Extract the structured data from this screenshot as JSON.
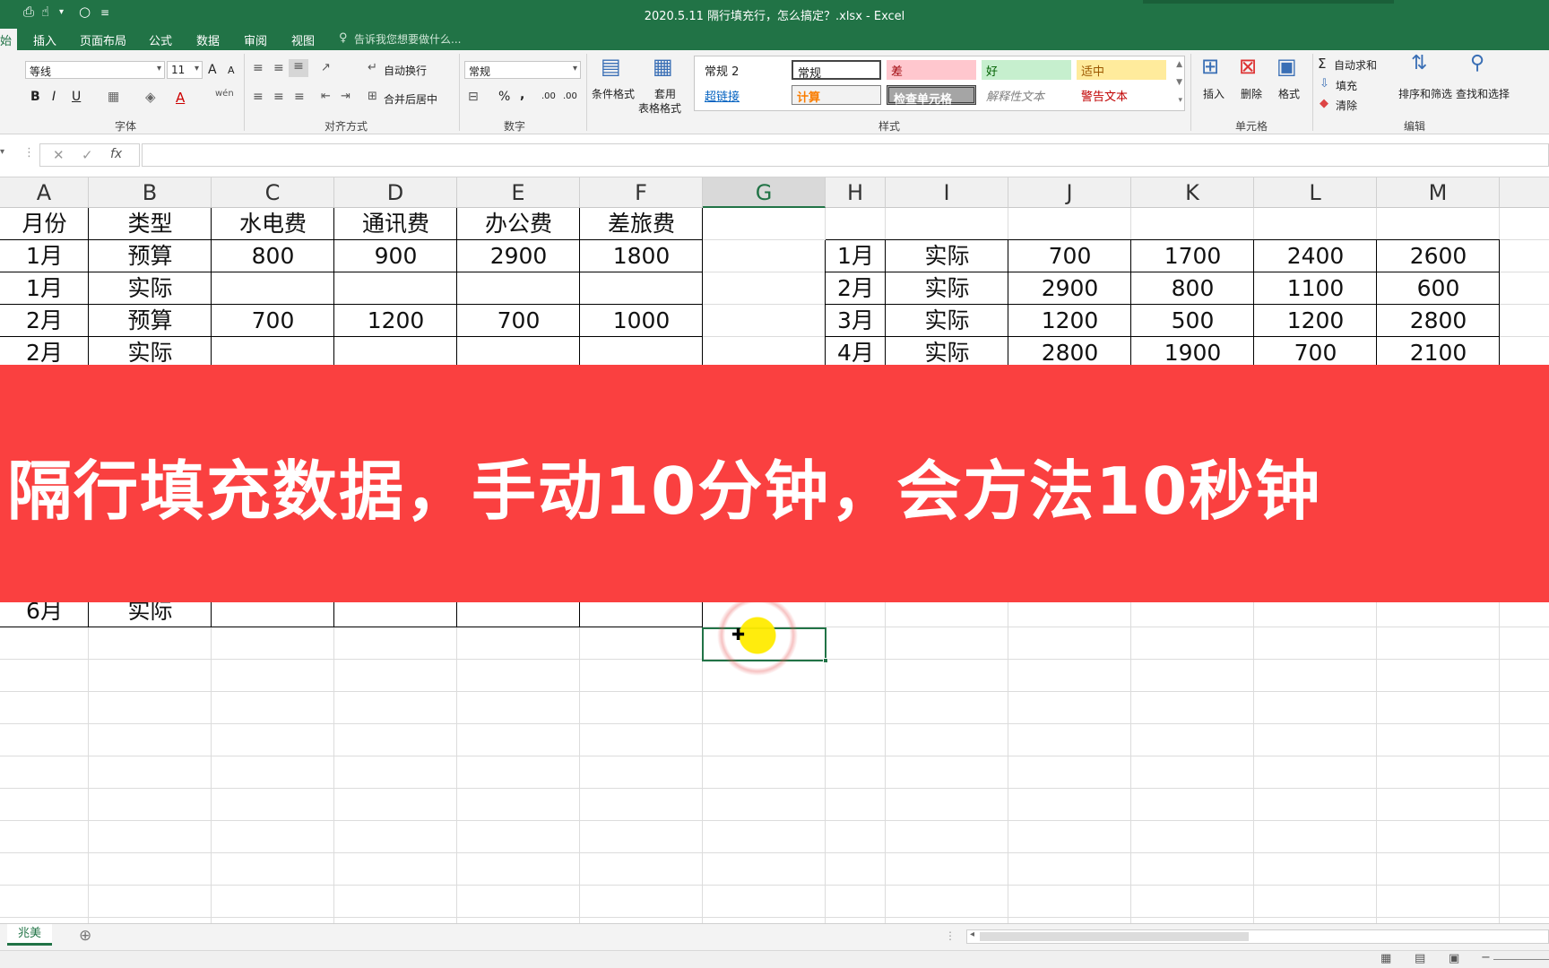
{
  "window": {
    "title": "2020.5.11 隔行填充行，怎么搞定？.xlsx - Excel"
  },
  "tabs": [
    {
      "label": "始",
      "active": true
    },
    {
      "label": "插入"
    },
    {
      "label": "页面布局"
    },
    {
      "label": "公式"
    },
    {
      "label": "数据"
    },
    {
      "label": "审阅"
    },
    {
      "label": "视图"
    }
  ],
  "tell_me": {
    "placeholder": "告诉我您想要做什么..."
  },
  "ribbon": {
    "font": {
      "name": "等线",
      "size": "11",
      "grow": "A",
      "shrink": "A",
      "bold": "B",
      "italic": "I",
      "underline": "U",
      "font_color": "A",
      "phonetic": "wén",
      "group_label": "字体"
    },
    "alignment": {
      "wrap_text": "自动换行",
      "merge_center": "合并后居中",
      "group_label": "对齐方式"
    },
    "number": {
      "format": "常规",
      "percent": "%",
      "comma": ",",
      "increase_decimal": ".00",
      "decrease_decimal": ".00",
      "group_label": "数字"
    },
    "styles": {
      "conditional_format": "条件格式",
      "format_as_table_line1": "套用",
      "format_as_table_line2": "表格格式",
      "gallery": [
        {
          "label": "常规 2"
        },
        {
          "label": "常规"
        },
        {
          "label": "差"
        },
        {
          "label": "好"
        },
        {
          "label": "适中"
        },
        {
          "label": "超链接"
        },
        {
          "label": "计算"
        },
        {
          "label": "检查单元格"
        },
        {
          "label": "解释性文本"
        },
        {
          "label": "警告文本"
        }
      ],
      "group_label": "样式"
    },
    "cells": {
      "insert": "插入",
      "delete": "删除",
      "format": "格式",
      "group_label": "单元格"
    },
    "editing": {
      "autosum": "自动求和",
      "fill": "填充",
      "clear": "清除",
      "sort_filter": "排序和筛选",
      "find_select": "查找和选择",
      "group_label": "编辑"
    }
  },
  "formula_bar": {
    "fx": "fx",
    "cancel": "✕",
    "enter": "✓",
    "content": ""
  },
  "columns": [
    "A",
    "B",
    "C",
    "D",
    "E",
    "F",
    "G",
    "H",
    "I",
    "J",
    "K",
    "L",
    "M"
  ],
  "selected_column": "G",
  "left_table": {
    "header": [
      "月份",
      "类型",
      "水电费",
      "通讯费",
      "办公费",
      "差旅费"
    ],
    "rows": [
      [
        "1月",
        "预算",
        "800",
        "900",
        "2900",
        "1800"
      ],
      [
        "1月",
        "实际",
        "",
        "",
        "",
        ""
      ],
      [
        "2月",
        "预算",
        "700",
        "1200",
        "700",
        "1000"
      ],
      [
        "2月",
        "实际",
        "",
        "",
        "",
        ""
      ]
    ],
    "last_row": [
      "6月",
      "实际",
      "",
      "",
      "",
      ""
    ]
  },
  "right_table": {
    "rows": [
      [
        "1月",
        "实际",
        "700",
        "1700",
        "2400",
        "2600"
      ],
      [
        "2月",
        "实际",
        "2900",
        "800",
        "1100",
        "600"
      ],
      [
        "3月",
        "实际",
        "1200",
        "500",
        "1200",
        "2800"
      ],
      [
        "4月",
        "实际",
        "2800",
        "1900",
        "700",
        "2100"
      ]
    ]
  },
  "banner": {
    "text": "隔行填充数据，手动10分钟，会方法10秒钟",
    "color": "#fa4040"
  },
  "sheet_tabs": [
    {
      "label": "兆美"
    }
  ],
  "add_sheet": "⊕",
  "colors": {
    "excel_green": "#217346"
  }
}
